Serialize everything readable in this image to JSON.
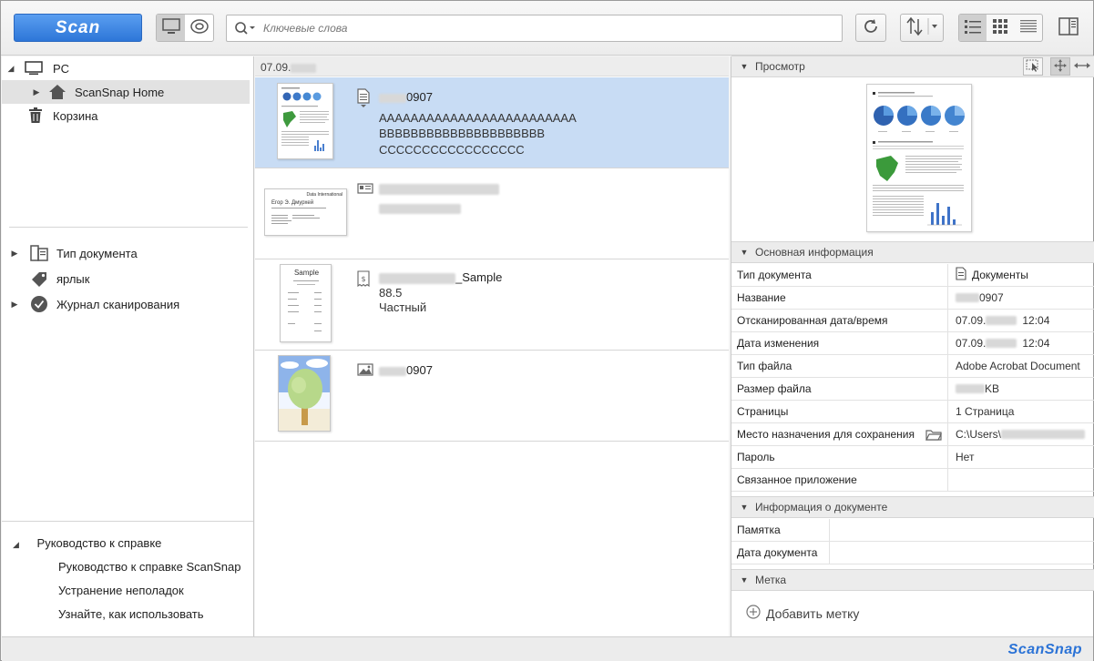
{
  "toolbar": {
    "scan_label": "Scan",
    "search_placeholder": "Ключевые слова"
  },
  "tree": {
    "pc_label": "PC",
    "home_label": "ScanSnap Home",
    "trash_label": "Корзина"
  },
  "filters": {
    "doctype_label": "Тип документа",
    "tag_label": "ярлык",
    "history_label": "Журнал сканирования"
  },
  "help": {
    "title": "Руководство к справке",
    "items": [
      "Руководство к справке ScanSnap",
      "Устранение неполадок",
      "Узнайте, как использовать"
    ]
  },
  "list": {
    "date_header": "07.09.",
    "items": [
      {
        "title": "0907",
        "lines": [
          "AAAAAAAAAAAAAAAAAAAAAAAAA",
          "BBBBBBBBBBBBBBBBBBBBB",
          "CCCCCCCCCCCCCCCCC"
        ]
      },
      {
        "title": "",
        "lines": []
      },
      {
        "title": "_Sample",
        "lines": [
          "88.5",
          "Частный"
        ]
      },
      {
        "title": "0907",
        "lines": []
      }
    ],
    "thumb_card_text": [
      "Data International",
      "Егор Э. Дмурхей"
    ],
    "thumb_receipt_title": "Sample"
  },
  "preview": {
    "header": "Просмотр"
  },
  "basic_info": {
    "header": "Основная информация",
    "rows": [
      {
        "key": "Тип документа",
        "value": "Документы"
      },
      {
        "key": "Название",
        "value": "0907"
      },
      {
        "key": "Отсканированная дата/время",
        "value": "07.09.",
        "value2": "12:04"
      },
      {
        "key": "Дата изменения",
        "value": "07.09.",
        "value2": "12:04"
      },
      {
        "key": "Тип файла",
        "value": "Adobe Acrobat Document"
      },
      {
        "key": "Размер файла",
        "value": "KB"
      },
      {
        "key": "Страницы",
        "value": "1 Страница"
      },
      {
        "key": "Место назначения для сохранения",
        "value": "C:\\Users\\"
      },
      {
        "key": "Пароль",
        "value": "Нет"
      },
      {
        "key": "Связанное приложение",
        "value": ""
      }
    ]
  },
  "doc_info": {
    "header": "Информация о документе",
    "rows": [
      {
        "key": "Памятка",
        "value": ""
      },
      {
        "key": "Дата документа",
        "value": ""
      }
    ]
  },
  "tags": {
    "header": "Метка",
    "add_label": "Добавить метку"
  },
  "status": {
    "logo": "ScanSnap"
  }
}
